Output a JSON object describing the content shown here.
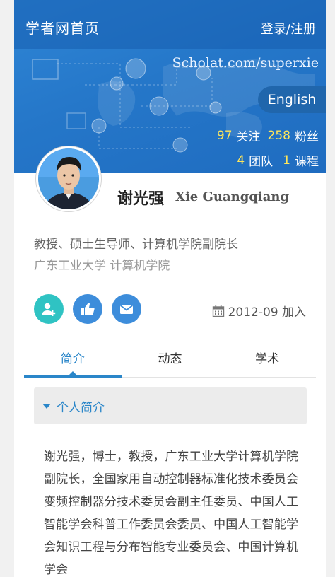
{
  "header": {
    "home_link": "学者网首页",
    "auth_link": "登录/注册"
  },
  "banner": {
    "url": "Scholat.com/superxie",
    "language_button": "English",
    "following_count": "97",
    "following_label": "关注",
    "followers_count": "258",
    "followers_label": "粉丝",
    "teams_count": "4",
    "teams_label": "团队",
    "courses_count": "1",
    "courses_label": "课程"
  },
  "profile": {
    "name_cn": "谢光强",
    "name_en": "Xie Guangqiang",
    "title": "教授、硕士生导师、计算机学院副院长",
    "organization": "广东工业大学 计算机学院",
    "joined": "2012-09 加入"
  },
  "actions": {
    "follow_icon": "add-user-icon",
    "like_icon": "thumbs-up-icon",
    "mail_icon": "envelope-icon"
  },
  "tabs": [
    {
      "label": "简介",
      "active": true
    },
    {
      "label": "动态",
      "active": false
    },
    {
      "label": "学术",
      "active": false
    }
  ],
  "section": {
    "title": "个人简介",
    "bio": "谢光强，博士，教授，广东工业大学计算机学院副院长，全国家用自动控制器标准化技术委员会变频控制器分技术委员会副主任委员、中国人工智能学会科普工作委员会委员、中国人工智能学会知识工程与分布智能专业委员会、中国计算机学会"
  },
  "colors": {
    "banner": "#2577c9",
    "accent": "#2a86c9",
    "highlight_number": "#ffe65a",
    "follow_button": "#2fc3c3",
    "like_button": "#3d8ddb"
  }
}
